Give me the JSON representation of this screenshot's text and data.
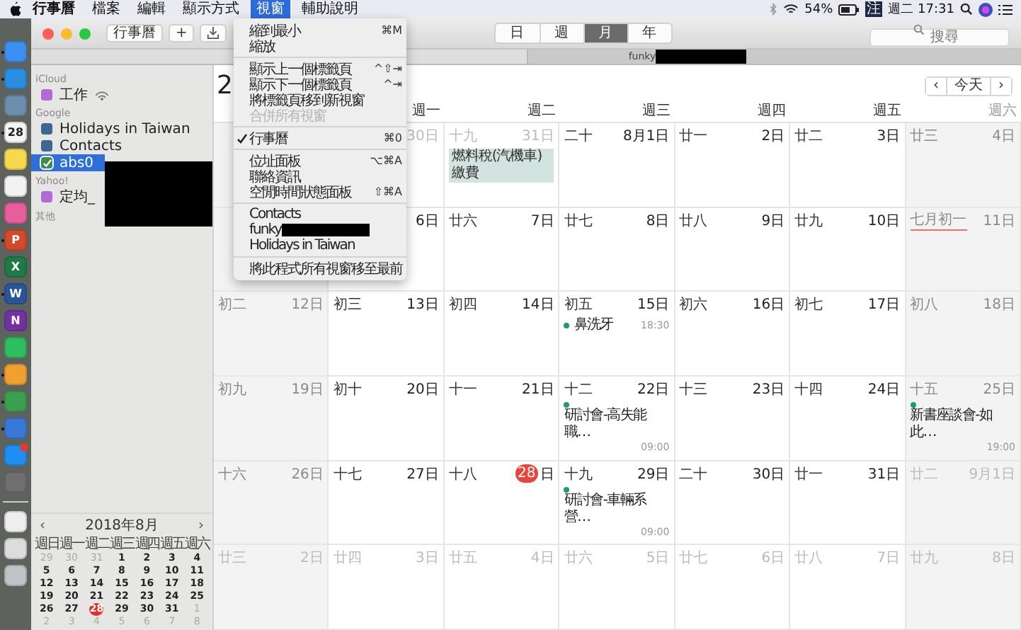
{
  "menubar": {
    "menus": [
      {
        "label": "行事曆",
        "kind": "app",
        "selected": false
      },
      {
        "label": "檔案",
        "kind": "menu",
        "selected": false
      },
      {
        "label": "編輯",
        "kind": "menu",
        "selected": false
      },
      {
        "label": "顯示方式",
        "kind": "menu",
        "selected": false
      },
      {
        "label": "視窗",
        "kind": "menu",
        "selected": true
      },
      {
        "label": "輔助說明",
        "kind": "menu",
        "selected": false
      }
    ],
    "battery_text": "54%",
    "input_method": "注",
    "clock": "週二 17:31"
  },
  "dock": {
    "apps": [
      {
        "color": "#3d8ff0",
        "running": true
      },
      {
        "color": "#2a8de0",
        "running": true
      },
      {
        "color": "#6d8fae",
        "running": false
      },
      {
        "color": "#f4f4f4",
        "running": true,
        "glyph": "28"
      },
      {
        "color": "#f5d94e",
        "running": false
      },
      {
        "color": "#f2f2f2",
        "running": false
      },
      {
        "color": "#e85d9c",
        "running": false
      },
      {
        "color": "#d04a2b",
        "running": true,
        "glyph": "P"
      },
      {
        "color": "#1f7a45",
        "running": false,
        "glyph": "X"
      },
      {
        "color": "#2a5699",
        "running": true,
        "glyph": "W"
      },
      {
        "color": "#7331a3",
        "running": false,
        "glyph": "N"
      },
      {
        "color": "#2dbe60",
        "running": false
      },
      {
        "color": "#f0a030",
        "running": true
      },
      {
        "color": "#3aa050",
        "running": true
      },
      {
        "color": "#3a78d8",
        "running": true
      },
      {
        "color": "#1f8ef1",
        "running": false,
        "badge": true
      },
      {
        "color": "#6f6f6f",
        "running": false
      },
      {
        "color": "#eeeeee",
        "running": false,
        "kind": "after-divider"
      },
      {
        "color": "#dcdcdc",
        "running": false
      },
      {
        "color": "#bfc3c6",
        "running": false
      }
    ]
  },
  "toolbar": {
    "calendars_button": "行事曆",
    "add_button": "+",
    "views": [
      {
        "label": "日",
        "selected": false
      },
      {
        "label": "週",
        "selected": false
      },
      {
        "label": "月",
        "selected": true
      },
      {
        "label": "年",
        "selected": false
      }
    ],
    "search": {
      "placeholder": "搜尋"
    }
  },
  "tabs": [
    {
      "label": "funky",
      "redacted": true
    }
  ],
  "sidebar": {
    "redaction": true,
    "sections": [
      {
        "title": "iCloud",
        "calendars": [
          {
            "name": "工作",
            "color": "#b36ad8",
            "selected": false,
            "shared": true
          }
        ]
      },
      {
        "title": "Google",
        "calendars": [
          {
            "name": "Holidays in Taiwan",
            "color": "#3f6593",
            "selected": false,
            "shared": false
          },
          {
            "name": "Contacts",
            "color": "#3f6593",
            "selected": false,
            "shared": false
          },
          {
            "name": "abs0",
            "color": "#3c8d4e",
            "selected": true,
            "shared": false
          }
        ]
      },
      {
        "title": "Yahoo!",
        "calendars": [
          {
            "name": "定均_",
            "color": "#b36ad8",
            "selected": false,
            "shared": false
          }
        ]
      },
      {
        "title": "其他"
      }
    ]
  },
  "mini_calendar": {
    "title": "2018年8月",
    "prev": "‹",
    "next": "›",
    "weekdays": [
      "週日",
      "週一",
      "週二",
      "週三",
      "週四",
      "週五",
      "週六"
    ],
    "weeks": [
      [
        {
          "day": "29",
          "in_month": false
        },
        {
          "day": "30",
          "in_month": false
        },
        {
          "day": "31",
          "in_month": false
        },
        {
          "day": "1",
          "in_month": true
        },
        {
          "day": "2",
          "in_month": true
        },
        {
          "day": "3",
          "in_month": true
        },
        {
          "day": "4",
          "in_month": true
        }
      ],
      [
        {
          "day": "5",
          "in_month": true
        },
        {
          "day": "6",
          "in_month": true
        },
        {
          "day": "7",
          "in_month": true
        },
        {
          "day": "8",
          "in_month": true
        },
        {
          "day": "9",
          "in_month": true
        },
        {
          "day": "10",
          "in_month": true
        },
        {
          "day": "11",
          "in_month": true
        }
      ],
      [
        {
          "day": "12",
          "in_month": true
        },
        {
          "day": "13",
          "in_month": true
        },
        {
          "day": "14",
          "in_month": true
        },
        {
          "day": "15",
          "in_month": true
        },
        {
          "day": "16",
          "in_month": true
        },
        {
          "day": "17",
          "in_month": true
        },
        {
          "day": "18",
          "in_month": true
        }
      ],
      [
        {
          "day": "19",
          "in_month": true
        },
        {
          "day": "20",
          "in_month": true
        },
        {
          "day": "21",
          "in_month": true
        },
        {
          "day": "22",
          "in_month": true
        },
        {
          "day": "23",
          "in_month": true
        },
        {
          "day": "24",
          "in_month": true
        },
        {
          "day": "25",
          "in_month": true
        }
      ],
      [
        {
          "day": "26",
          "in_month": true
        },
        {
          "day": "27",
          "in_month": true
        },
        {
          "day": "28",
          "in_month": true,
          "today": true
        },
        {
          "day": "29",
          "in_month": true
        },
        {
          "day": "30",
          "in_month": true
        },
        {
          "day": "31",
          "in_month": true
        },
        {
          "day": "1",
          "in_month": false
        }
      ],
      [
        {
          "day": "2",
          "in_month": false
        },
        {
          "day": "3",
          "in_month": false
        },
        {
          "day": "4",
          "in_month": false
        },
        {
          "day": "5",
          "in_month": false
        },
        {
          "day": "6",
          "in_month": false
        },
        {
          "day": "7",
          "in_month": false
        },
        {
          "day": "8",
          "in_month": false
        }
      ]
    ]
  },
  "calendar": {
    "title": "2",
    "prev": "‹",
    "today_button": "今天",
    "next": "›",
    "weekdays": [
      {
        "weekend": true
      },
      {
        "label": "週一",
        "weekend": false
      },
      {
        "label": "週二",
        "weekend": false
      },
      {
        "label": "週三",
        "weekend": false
      },
      {
        "label": "週四",
        "weekend": false
      },
      {
        "label": "週五",
        "weekend": false
      },
      {
        "label": "週六",
        "weekend": true
      }
    ],
    "weeks": [
      [
        {
          "day": "30日",
          "in_month": false
        },
        {
          "lunar": "十九",
          "day": "31日",
          "in_month": false,
          "events": [
            {
              "kind": "allday",
              "title": "燃料稅(汽機車)繳費"
            }
          ]
        },
        {
          "lunar": "二十",
          "day": "8月1日",
          "in_month": true
        },
        {
          "lunar": "廿一",
          "day": "2日",
          "in_month": true
        },
        {
          "lunar": "廿二",
          "day": "3日",
          "in_month": true
        },
        {
          "lunar": "廿三",
          "day": "4日",
          "in_month": true
        }
      ],
      [
        {
          "day": "6日",
          "in_month": true
        },
        {
          "lunar": "廿六",
          "day": "7日",
          "in_month": true
        },
        {
          "lunar": "廿七",
          "day": "8日",
          "in_month": true
        },
        {
          "lunar": "廿八",
          "day": "9日",
          "in_month": true
        },
        {
          "lunar": "廿九",
          "day": "10日",
          "in_month": true
        },
        {
          "lunar": "七月初一",
          "day": "11日",
          "in_month": true,
          "month_start": true
        }
      ],
      [
        {
          "lunar": "初二",
          "day": "12日",
          "in_month": true
        },
        {
          "lunar": "初三",
          "day": "13日",
          "in_month": true
        },
        {
          "lunar": "初四",
          "day": "14日",
          "in_month": true
        },
        {
          "lunar": "初五",
          "day": "15日",
          "in_month": true,
          "events": [
            {
              "kind": "timed",
              "title": "鼻洗牙",
              "time": "18:30",
              "color": "#1e9a78"
            }
          ]
        },
        {
          "lunar": "初六",
          "day": "16日",
          "in_month": true
        },
        {
          "lunar": "初七",
          "day": "17日",
          "in_month": true
        },
        {
          "lunar": "初八",
          "day": "18日",
          "in_month": true
        }
      ],
      [
        {
          "lunar": "初九",
          "day": "19日",
          "in_month": true
        },
        {
          "lunar": "初十",
          "day": "20日",
          "in_month": true
        },
        {
          "lunar": "十一",
          "day": "21日",
          "in_month": true
        },
        {
          "lunar": "十二",
          "day": "22日",
          "in_month": true,
          "events": [
            {
              "kind": "timed",
              "title": "研討會-高失能職…",
              "time": "09:00",
              "color": "#1e9a78"
            }
          ]
        },
        {
          "lunar": "十三",
          "day": "23日",
          "in_month": true
        },
        {
          "lunar": "十四",
          "day": "24日",
          "in_month": true
        },
        {
          "lunar": "十五",
          "day": "25日",
          "in_month": true,
          "events": [
            {
              "kind": "timed",
              "title": "新書座談會-如此…",
              "time": "19:00",
              "color": "#1e9a78"
            }
          ]
        }
      ],
      [
        {
          "lunar": "十六",
          "day": "26日",
          "in_month": true
        },
        {
          "lunar": "十七",
          "day": "27日",
          "in_month": true
        },
        {
          "lunar": "十八",
          "day": "28",
          "suffix": "日",
          "in_month": true,
          "today": true
        },
        {
          "lunar": "十九",
          "day": "29日",
          "in_month": true,
          "events": [
            {
              "kind": "timed",
              "title": "研討會-車輛系營…",
              "time": "09:00",
              "color": "#1e9a78"
            }
          ]
        },
        {
          "lunar": "二十",
          "day": "30日",
          "in_month": true
        },
        {
          "lunar": "廿一",
          "day": "31日",
          "in_month": true
        },
        {
          "lunar": "廿二",
          "day": "9月1日",
          "in_month": false
        }
      ],
      [
        {
          "lunar": "廿三",
          "day": "2日",
          "in_month": false
        },
        {
          "lunar": "廿四",
          "day": "3日",
          "in_month": false
        },
        {
          "lunar": "廿五",
          "day": "4日",
          "in_month": false
        },
        {
          "lunar": "廿六",
          "day": "5日",
          "in_month": false
        },
        {
          "lunar": "廿七",
          "day": "6日",
          "in_month": false
        },
        {
          "lunar": "廿八",
          "day": "7日",
          "in_month": false
        },
        {
          "lunar": "廿九",
          "day": "8日",
          "in_month": false
        }
      ]
    ]
  },
  "window_menu": {
    "items": [
      {
        "kind": "item",
        "label": "縮到最小",
        "shortcut": "⌘M",
        "disabled": false,
        "checked": false
      },
      {
        "kind": "item",
        "label": "縮放",
        "disabled": false,
        "checked": false
      },
      {
        "kind": "separator"
      },
      {
        "kind": "item",
        "label": "顯示上一個標籤頁",
        "shortcut": "^⇧⇥",
        "disabled": false,
        "checked": false
      },
      {
        "kind": "item",
        "label": "顯示下一個標籤頁",
        "shortcut": "^⇥",
        "disabled": false,
        "checked": false
      },
      {
        "kind": "item",
        "label": "將標籤頁移到新視窗",
        "disabled": false,
        "checked": false
      },
      {
        "kind": "item",
        "label": "合併所有視窗",
        "disabled": true,
        "checked": false
      },
      {
        "kind": "separator"
      },
      {
        "kind": "item",
        "label": "行事曆",
        "shortcut": "⌘0",
        "disabled": false,
        "checked": true
      },
      {
        "kind": "separator"
      },
      {
        "kind": "item",
        "label": "位址面板",
        "shortcut": "⌥⌘A",
        "disabled": false,
        "checked": false
      },
      {
        "kind": "item",
        "label": "聯絡資訊",
        "disabled": false,
        "checked": false
      },
      {
        "kind": "item",
        "label": "空閒時間狀態面板",
        "shortcut": "⇧⌘A",
        "disabled": false,
        "checked": false
      },
      {
        "kind": "separator"
      },
      {
        "kind": "item",
        "label": "Contacts",
        "disabled": false,
        "checked": false
      },
      {
        "kind": "item",
        "label": "funky",
        "disabled": false,
        "checked": false,
        "redacted": true
      },
      {
        "kind": "item",
        "label": "Holidays in Taiwan",
        "disabled": false,
        "checked": false
      },
      {
        "kind": "separator"
      },
      {
        "kind": "item",
        "label": "將此程式所有視窗移至最前",
        "disabled": false,
        "checked": false
      }
    ]
  }
}
